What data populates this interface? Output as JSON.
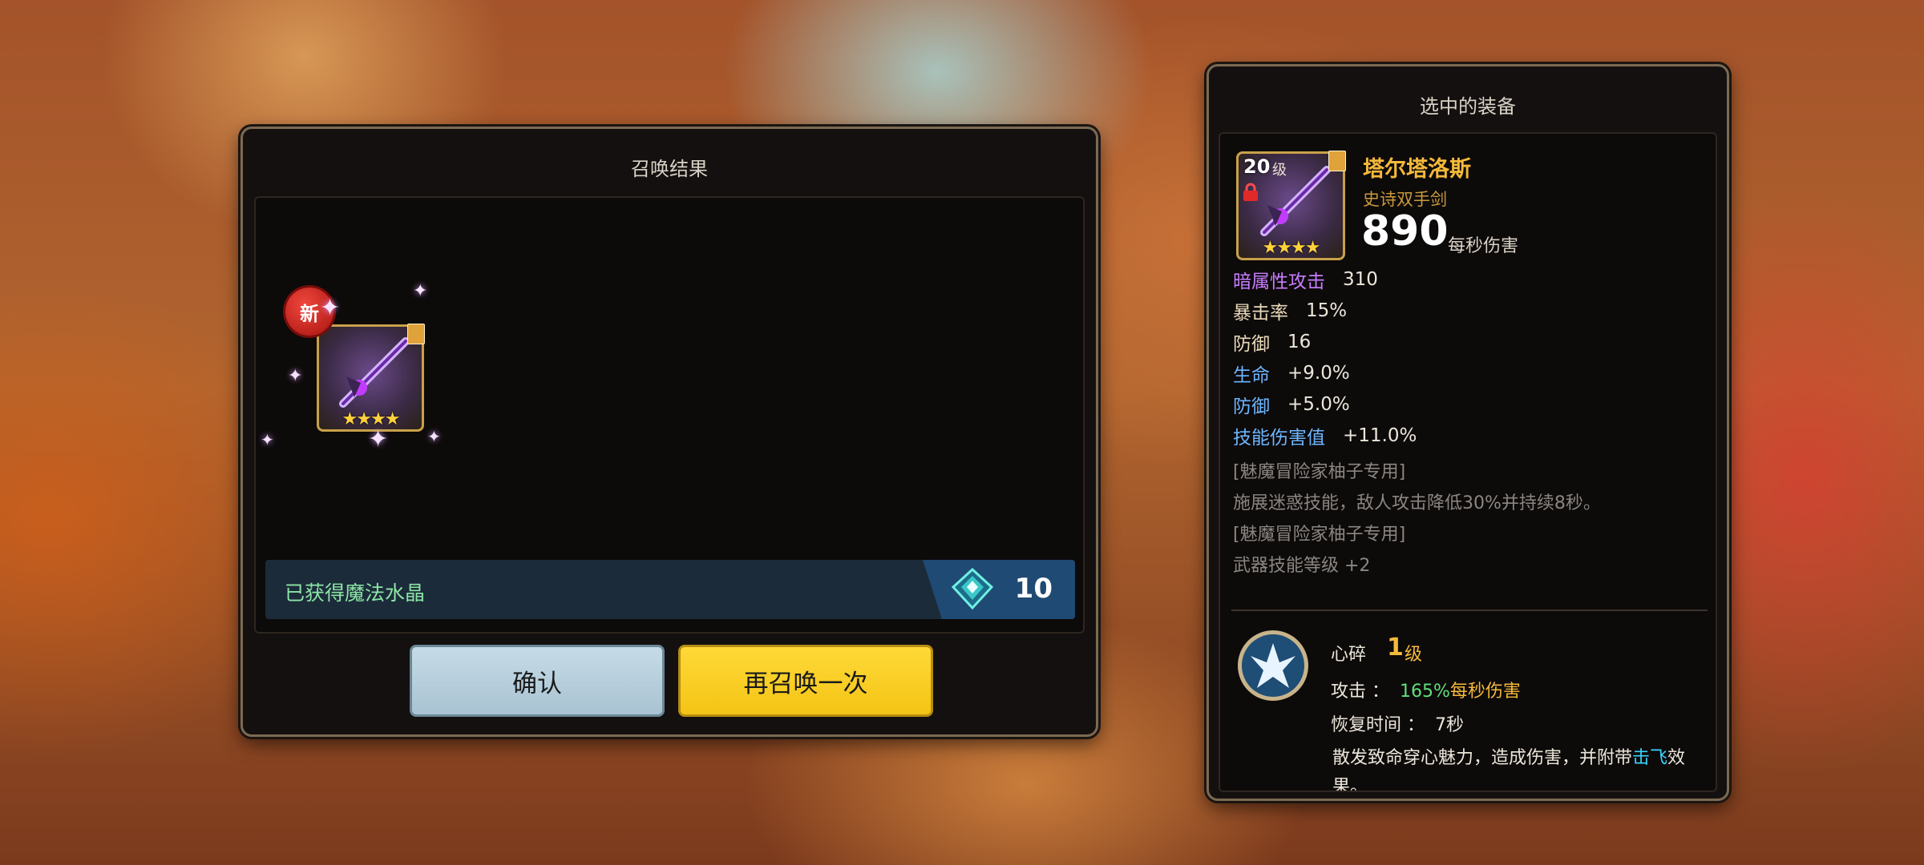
{
  "summon_panel": {
    "title": "召唤结果",
    "new_badge": "新",
    "item_stars": "★★★★",
    "crystal_label": "已获得魔法水晶",
    "crystal_count": "10",
    "confirm_label": "确认",
    "resummon_label": "再召唤一次"
  },
  "detail_panel": {
    "title": "选中的装备",
    "level": "20",
    "level_unit": "级",
    "stars": "★★★★",
    "name": "塔尔塔洛斯",
    "type": "史诗双手剑",
    "dps": "890",
    "dps_unit": "每秒伤害",
    "stats": [
      {
        "label": "暗属性攻击",
        "value": "310",
        "color": "#c77dff"
      },
      {
        "label": "暴击率",
        "value": "15%",
        "color": "#e9d9b9"
      },
      {
        "label": "防御",
        "value": "16",
        "color": "#e9d9b9"
      },
      {
        "label": "生命",
        "value": "+9.0%",
        "color": "#6db6ff"
      },
      {
        "label": "防御",
        "value": "+5.0%",
        "color": "#6db6ff"
      },
      {
        "label": "技能伤害值",
        "value": "+11.0%",
        "color": "#6db6ff"
      }
    ],
    "exclusive_1": "[魅魔冒险家柚子专用]",
    "effect_1": "施展迷惑技能，敌人攻击降低30%并持续8秒。",
    "exclusive_2": "[魅魔冒险家柚子专用]",
    "effect_2": "武器技能等级 +2",
    "skill": {
      "name": "心碎",
      "level": "1",
      "level_unit": "级",
      "attack_label": "攻击 ：",
      "attack_value": "165%",
      "attack_unit": "每秒伤害",
      "cooldown_label": "恢复时间 ：",
      "cooldown_value": "7秒",
      "desc": "散发致命穿心魅力，造成伤害，并附带",
      "desc_highlight": "击飞",
      "desc_end": "效果。"
    }
  },
  "colors": {
    "gold": "#f5b93a",
    "green": "#5ee07a",
    "cyan": "#38d6ff",
    "resummon": "#ffd938",
    "confirm": "#b8d0de"
  }
}
